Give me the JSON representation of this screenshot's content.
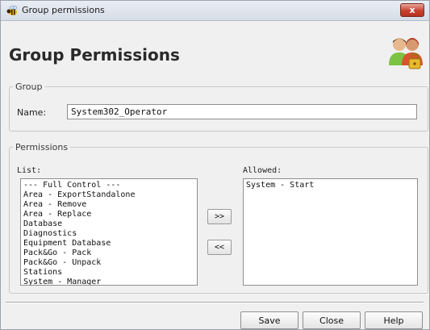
{
  "window": {
    "title": "Group permissions",
    "close_glyph": "x",
    "app_icon": "bee-icon"
  },
  "header": {
    "title": "Group Permissions",
    "icon": "users-lock-icon"
  },
  "group": {
    "legend": "Group",
    "name_label": "Name:",
    "name_value": "System302_Operator"
  },
  "permissions": {
    "legend": "Permissions",
    "list_label": "List:",
    "allowed_label": "Allowed:",
    "available": [
      "--- Full Control ---",
      "Area - ExportStandalone",
      "Area - Remove",
      "Area - Replace",
      "Database",
      "Diagnostics",
      "Equipment Database",
      "Pack&Go - Pack",
      "Pack&Go - Unpack",
      "Stations",
      "System - Manager"
    ],
    "allowed": [
      "System - Start"
    ],
    "add_label": ">>",
    "remove_label": "<<"
  },
  "footer": {
    "save_label": "Save",
    "close_label": "Close",
    "help_label": "Help"
  },
  "colors": {
    "close_button": "#c8412f",
    "dialog_background": "#f0f0f0"
  }
}
